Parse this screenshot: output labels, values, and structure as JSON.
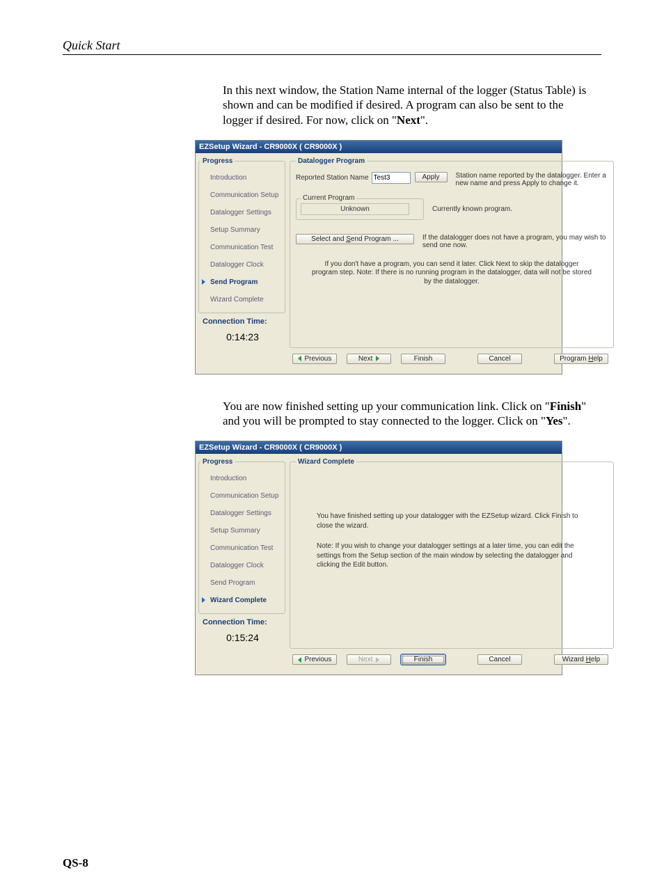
{
  "page": {
    "header": "Quick Start",
    "footer": "QS-8"
  },
  "para1": {
    "t1": "In this next window, the Station Name internal of the logger (Status Table) is shown and can be modified if desired.  A program can also be sent to the logger if desired.  For now, click on \"",
    "b1": "Next",
    "t2": "\"."
  },
  "para2": {
    "t1": "You are now finished setting up your communication link.  Click on \"",
    "b1": "Finish",
    "t2": "\" and you will be prompted to stay connected to the logger.  Click on \"",
    "b2": "Yes",
    "t3": "\"."
  },
  "wiz1": {
    "title": "EZSetup Wizard - CR9000X ( CR9000X )",
    "progress_label": "Progress",
    "steps": {
      "intro": "Introduction",
      "comm": "Communication Setup",
      "dls": "Datalogger Settings",
      "sum": "Setup Summary",
      "ctest": "Communication Test",
      "clock": "Datalogger Clock",
      "send": "Send Program",
      "done": "Wizard Complete"
    },
    "conn_label": "Connection Time:",
    "conn_time": "0:14:23",
    "panel_title": "Datalogger Program",
    "station_label": "Reported Station Name",
    "station_value": "Test3",
    "apply": "Apply",
    "station_help": "Station name reported by the datalogger. Enter a new name and press Apply to change it.",
    "curprog_label": "Current Program",
    "curprog_value": "Unknown",
    "curprog_help": "Currently known program.",
    "select_send": "Select and Send Program ...",
    "select_send_u": "S",
    "send_help": "If the datalogger does not have a program, you may wish to send one now.",
    "note": "If you don't have a program, you can send it later.  Click Next to skip the datalogger program step.  Note: If there is no running program in the datalogger, data will not be stored by the datalogger.",
    "buttons": {
      "prev": "Previous",
      "next": "Next",
      "finish": "Finish",
      "cancel": "Cancel",
      "help": "Program Help",
      "help_u": "H"
    }
  },
  "wiz2": {
    "title": "EZSetup Wizard - CR9000X ( CR9000X )",
    "progress_label": "Progress",
    "conn_label": "Connection Time:",
    "conn_time": "0:15:24",
    "panel_title": "Wizard Complete",
    "line1": "You have finished setting up your datalogger with the EZSetup wizard. Click Finish to close the wizard.",
    "line2": "Note: If you wish to change your datalogger settings at a later time, you can edit the settings from the Setup section of the main window by selecting the datalogger and clicking the Edit button.",
    "buttons": {
      "prev": "Previous",
      "next": "Next",
      "finish": "Finish",
      "cancel": "Cancel",
      "help": "Wizard Help",
      "help_u": "H"
    }
  }
}
